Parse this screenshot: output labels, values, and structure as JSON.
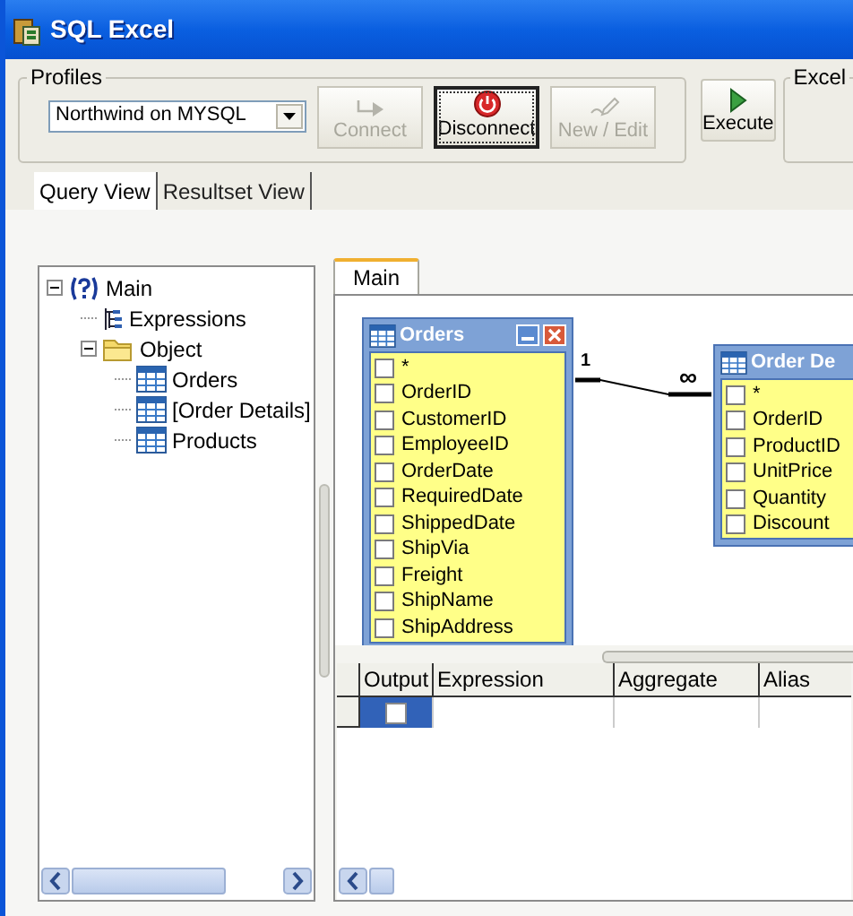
{
  "window": {
    "title": "SQL Excel"
  },
  "profiles": {
    "label": "Profiles",
    "selected_profile": "Northwind on MYSQL"
  },
  "toolbar_buttons": [
    {
      "label": "Connect",
      "kind": "connect",
      "disabled": true,
      "focused": false
    },
    {
      "label": "Disconnect",
      "kind": "disconnect",
      "disabled": false,
      "focused": true
    },
    {
      "label": "New / Edit",
      "kind": "edit",
      "disabled": true,
      "focused": false
    }
  ],
  "execute_button": {
    "label": "Execute"
  },
  "excel_group": {
    "label": "Excel"
  },
  "view_tabs": [
    {
      "label": "Query View",
      "selected": true
    },
    {
      "label": "Resultset View",
      "selected": false
    }
  ],
  "tree": [
    {
      "label": "Main",
      "kind": "query",
      "expanded": true,
      "children": [
        {
          "label": "Expressions",
          "kind": "expressions"
        },
        {
          "label": "Object",
          "kind": "folder",
          "expanded": true,
          "children": [
            {
              "label": "Orders",
              "kind": "table"
            },
            {
              "label": "[Order Details]",
              "kind": "table"
            },
            {
              "label": "Products",
              "kind": "table"
            }
          ]
        }
      ]
    }
  ],
  "diagram_tabs": [
    {
      "label": "Main",
      "selected": true
    }
  ],
  "tables": [
    {
      "name": "Orders",
      "fields": [
        {
          "name": "*",
          "checked": false
        },
        {
          "name": "OrderID",
          "checked": false
        },
        {
          "name": "CustomerID",
          "checked": false
        },
        {
          "name": "EmployeeID",
          "checked": false
        },
        {
          "name": "OrderDate",
          "checked": false
        },
        {
          "name": "RequiredDate",
          "checked": false
        },
        {
          "name": "ShippedDate",
          "checked": false
        },
        {
          "name": "ShipVia",
          "checked": false
        },
        {
          "name": "Freight",
          "checked": false
        },
        {
          "name": "ShipName",
          "checked": false
        },
        {
          "name": "ShipAddress",
          "checked": false
        }
      ]
    },
    {
      "name": "Order De",
      "fields": [
        {
          "name": "*",
          "checked": false
        },
        {
          "name": "OrderID",
          "checked": false
        },
        {
          "name": "ProductID",
          "checked": false
        },
        {
          "name": "UnitPrice",
          "checked": false
        },
        {
          "name": "Quantity",
          "checked": false
        },
        {
          "name": "Discount",
          "checked": false
        }
      ]
    }
  ],
  "relation": {
    "from_label": "1",
    "to_label": "∞"
  },
  "grid": {
    "columns": [
      "Output",
      "Expression",
      "Aggregate",
      "Alias"
    ],
    "rows": [
      {
        "selected": true,
        "output": false
      }
    ]
  }
}
